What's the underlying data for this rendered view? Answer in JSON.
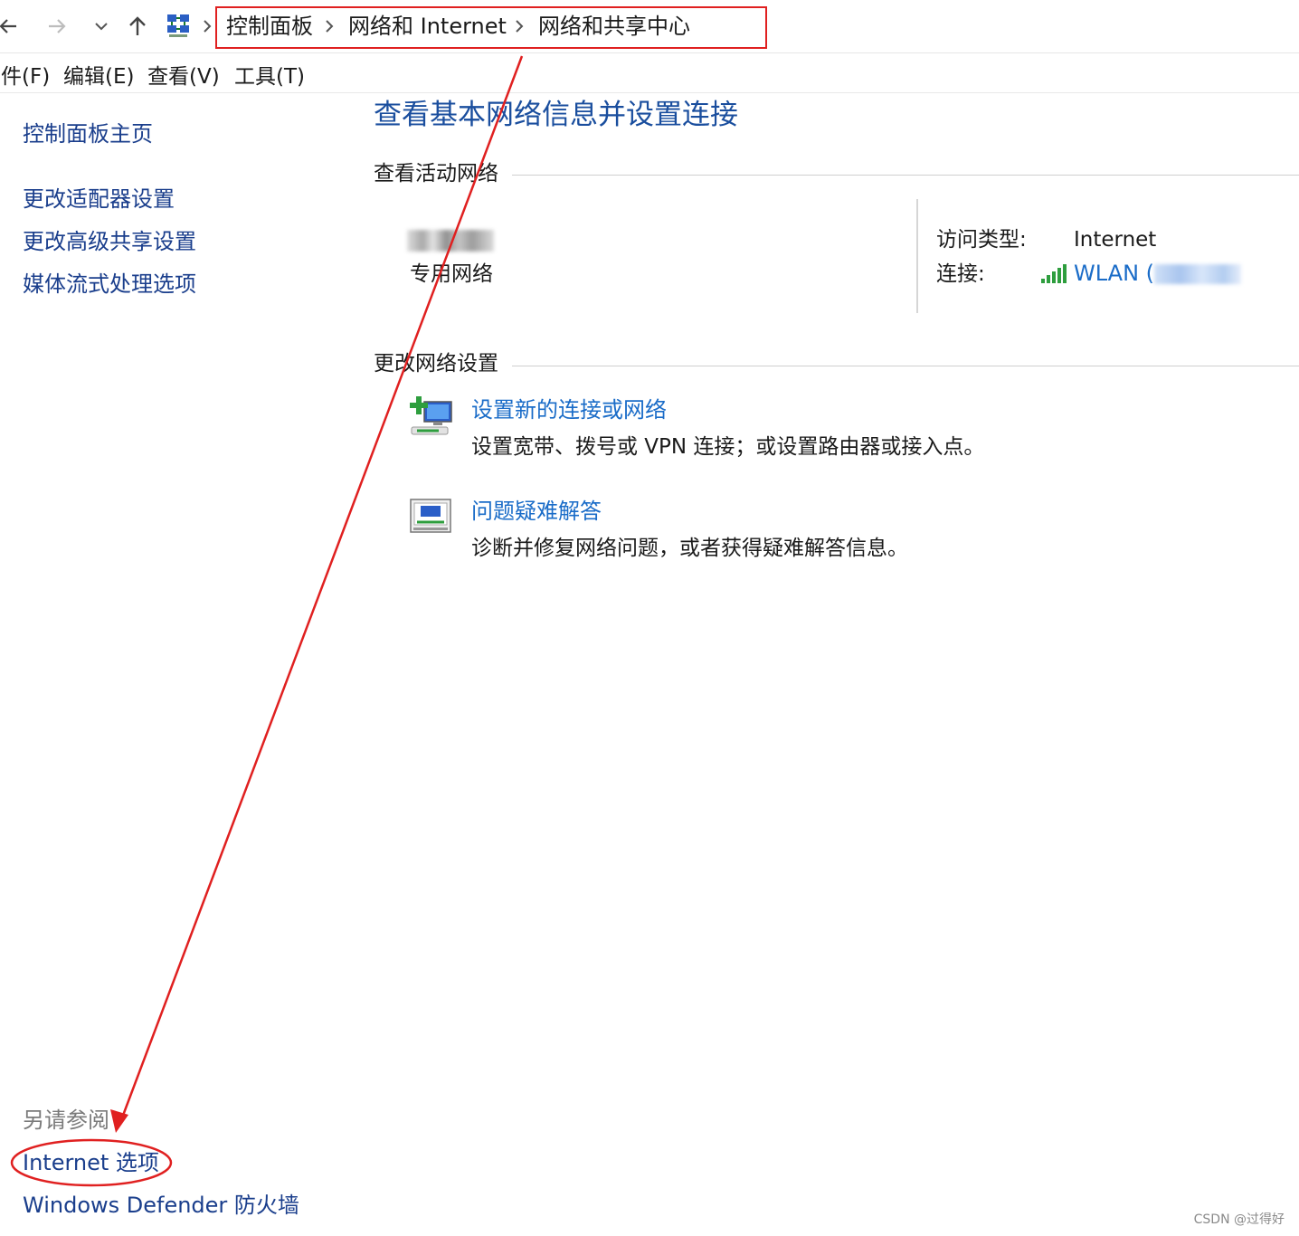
{
  "nav": {
    "breadcrumbs": [
      "控制面板",
      "网络和 Internet",
      "网络和共享中心"
    ]
  },
  "menu": {
    "items": [
      "件(F)",
      "编辑(E)",
      "查看(V)",
      "工具(T)"
    ]
  },
  "left_pane": {
    "links": [
      "控制面板主页",
      "更改适配器设置",
      "更改高级共享设置",
      "媒体流式处理选项"
    ],
    "see_also_label": "另请参阅",
    "see_also_links": [
      "Internet 选项",
      "Windows Defender 防火墙"
    ]
  },
  "main": {
    "title": "查看基本网络信息并设置连接",
    "active_networks_header": "查看活动网络",
    "network_type": "专用网络",
    "access_type_label": "访问类型:",
    "access_type_value": "Internet",
    "connection_label": "连接:",
    "connection_value": "WLAN (",
    "change_settings_header": "更改网络设置",
    "tasks": [
      {
        "title": "设置新的连接或网络",
        "description": "设置宽带、拨号或 VPN 连接；或设置路由器或接入点。",
        "icon": "network-setup-icon"
      },
      {
        "title": "问题疑难解答",
        "description": "诊断并修复网络问题，或者获得疑难解答信息。",
        "icon": "troubleshoot-icon"
      }
    ]
  },
  "watermark": "CSDN @过得好",
  "colors": {
    "annotation_red": "#e02020",
    "link_blue": "#1a6cc8",
    "title_blue": "#1a4e9e"
  }
}
